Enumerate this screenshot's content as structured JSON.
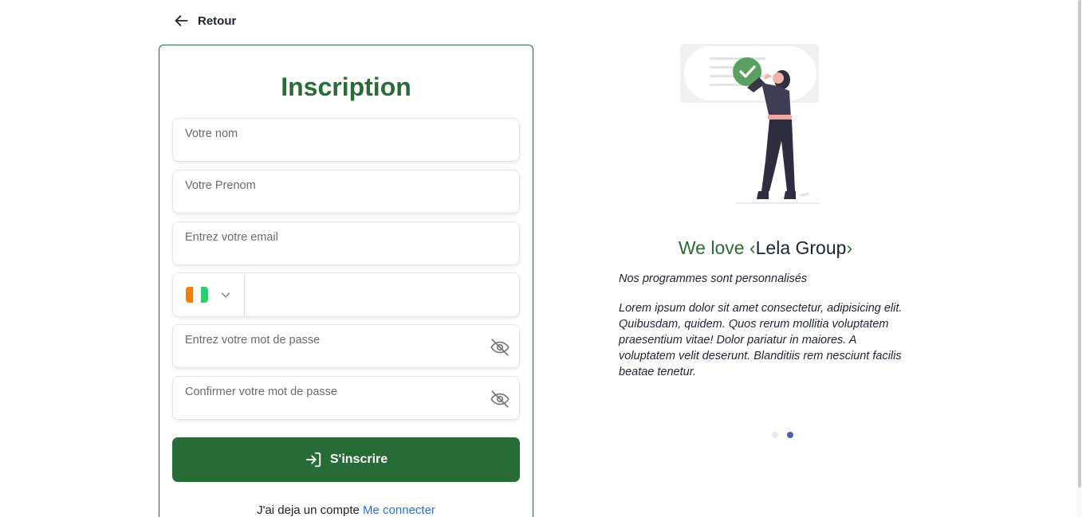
{
  "nav": {
    "back_label": "Retour"
  },
  "form": {
    "title": "Inscription",
    "nom_placeholder": "Votre nom",
    "prenom_placeholder": "Votre Prenom",
    "email_placeholder": "Entrez votre email",
    "phone_placeholder": "",
    "password_placeholder": "Entrez votre mot de passe",
    "confirm_placeholder": "Confirmer votre mot de passe",
    "submit_label": "S'inscrire",
    "login_prompt": "J'ai deja un compte",
    "login_link": "Me connecter"
  },
  "country_flag_colors": [
    "#f77f00",
    "#ffffff",
    "#2ecc71"
  ],
  "colors": {
    "brand_green": "#276b36",
    "link_blue": "#2b6fd4",
    "dot_inactive": "#e6e8f2",
    "dot_active": "#4b5fb8"
  },
  "icons": {
    "back": "arrow-left-icon",
    "chevron": "chevron-down-icon",
    "eye": "eye-off-icon",
    "submit": "sign-in-icon"
  },
  "promo": {
    "tagline_prefix": "We love",
    "tagline_open": "‹",
    "brand": "Lela Group",
    "tagline_close": "›",
    "subtitle": "Nos programmes sont personnalisés",
    "description": "Lorem ipsum dolor sit amet consectetur, adipisicing elit. Quibusdam, quidem. Quos rerum mollitia voluptatem praesentium vitae! Dolor pariatur in maiores. A voluptatem velit deserunt. Blanditiis rem nesciunt facilis beatae tenetur."
  },
  "carousel": {
    "active_index": 1,
    "count": 2
  }
}
